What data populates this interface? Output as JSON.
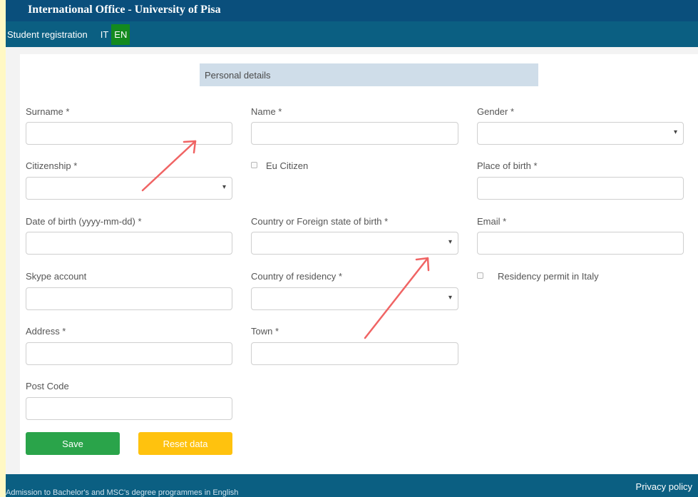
{
  "header": {
    "title": "International Office - University of Pisa",
    "nav_label": "Student registration",
    "lang_it": "IT",
    "lang_en": "EN"
  },
  "section": {
    "title": "Personal details"
  },
  "fields": {
    "surname": "Surname *",
    "name": "Name *",
    "gender": "Gender *",
    "citizenship": "Citizenship *",
    "eu_citizen": "Eu Citizen",
    "place_of_birth": "Place of birth *",
    "date_of_birth": "Date of birth (yyyy-mm-dd) *",
    "country_of_birth": "Country or Foreign state of birth *",
    "email": "Email *",
    "skype": "Skype account",
    "country_of_residency": "Country of residency *",
    "residency_permit": "Residency permit in Italy",
    "address": "Address *",
    "town": "Town *",
    "post_code": "Post Code"
  },
  "buttons": {
    "save": "Save",
    "reset": "Reset data"
  },
  "footer": {
    "left_text": "Admission to Bachelor's and MSC's degree programmes in English",
    "privacy": "Privacy policy"
  },
  "colors": {
    "header_bg": "#0b5f82",
    "active_lang": "#138a1e",
    "save": "#2aa44a",
    "reset": "#ffc20e",
    "annotation_arrow": "#f06464",
    "outer_bg": "#fff8c4"
  }
}
